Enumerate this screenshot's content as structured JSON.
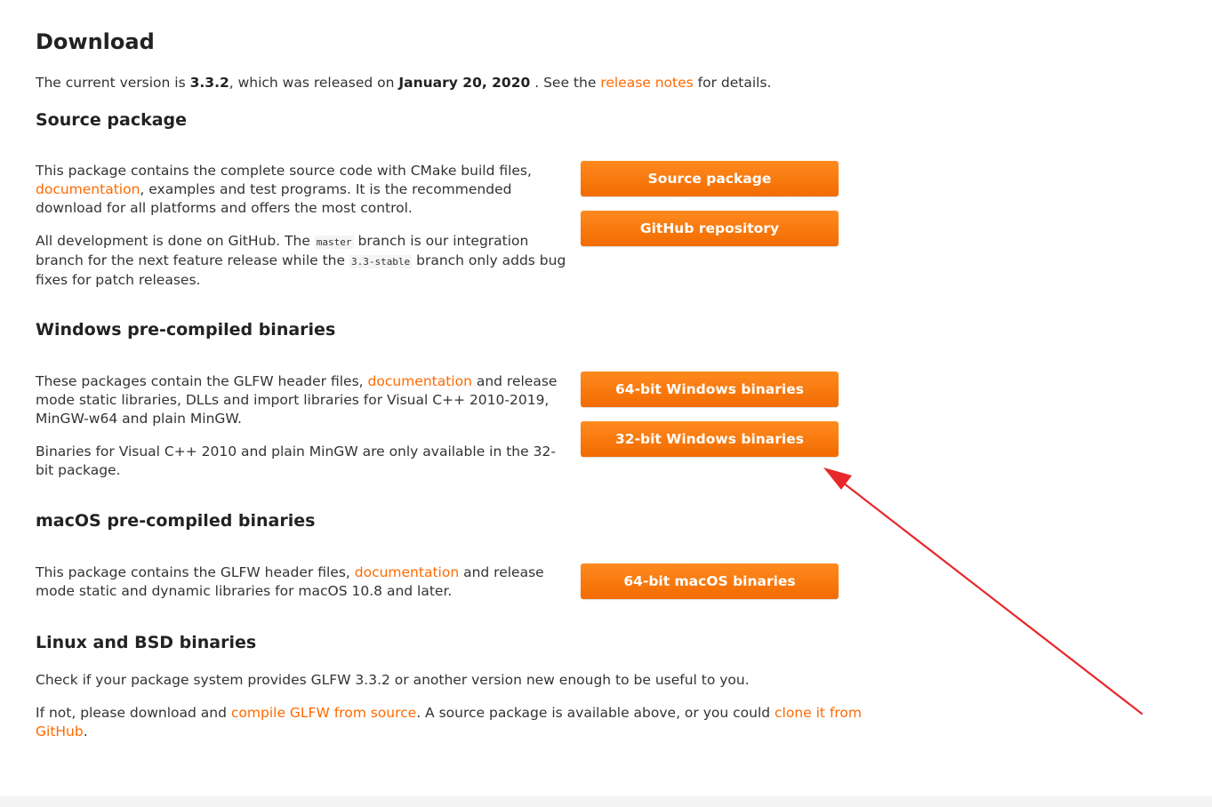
{
  "page": {
    "title": "Download",
    "intro": {
      "prefix": "The current version is ",
      "version": "3.3.2",
      "middle": ", which was released on ",
      "date": "January 20, 2020",
      "after_date": " . See the ",
      "link": "release notes",
      "suffix": " for details."
    }
  },
  "source": {
    "heading": "Source package",
    "p1_before": "This package contains the complete source code with CMake build files, ",
    "p1_link": "documentation",
    "p1_after": ", examples and test programs. It is the recommended download for all platforms and offers the most control.",
    "p2_a": "All development is done on GitHub. The ",
    "p2_code1": "master",
    "p2_b": " branch is our integration branch for the next feature release while the ",
    "p2_code2": "3.3-stable",
    "p2_c": " branch only adds bug fixes for patch releases.",
    "btn_source": "Source package",
    "btn_github": "GitHub repository"
  },
  "windows": {
    "heading": "Windows pre-compiled binaries",
    "p1_before": "These packages contain the GLFW header files, ",
    "p1_link": "documentation",
    "p1_after": " and release mode static libraries, DLLs and import libraries for Visual C++ 2010-2019, MinGW-w64 and plain MinGW.",
    "p2": "Binaries for Visual C++ 2010 and plain MinGW are only available in the 32-bit package.",
    "btn_64": "64-bit Windows binaries",
    "btn_32": "32-bit Windows binaries"
  },
  "macos": {
    "heading": "macOS pre-compiled binaries",
    "p1_before": "This package contains the GLFW header files, ",
    "p1_link": "documentation",
    "p1_after": " and release mode static and dynamic libraries for macOS 10.8 and later.",
    "btn_64": "64-bit macOS binaries"
  },
  "linux": {
    "heading": "Linux and BSD binaries",
    "p1": "Check if your package system provides GLFW 3.3.2 or another version new enough to be useful to you.",
    "p2_before": "If not, please download and ",
    "p2_link1": "compile GLFW from source",
    "p2_middle": ". A source package is available above, or you could ",
    "p2_link2": "clone it from GitHub",
    "p2_after": "."
  },
  "colors": {
    "accent": "#ff6a00",
    "button": "#f57c00",
    "arrow": "#e8282b"
  }
}
